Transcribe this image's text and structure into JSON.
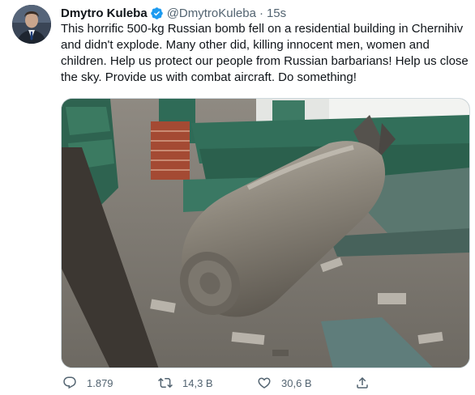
{
  "tweet": {
    "author_name": "Dmytro Kuleba",
    "handle": "@DmytroKuleba",
    "separator": "·",
    "time": "15s",
    "text": "This horrific 500-kg Russian bomb fell on a residential building in Chernihiv and didn't explode. Many other did, killing innocent men, women and children. Help us protect our people from Russian barbarians! Help us close the sky. Provide us with combat aircraft. Do something!"
  },
  "actions": {
    "reply_count": "1.879",
    "retweet_count": "14,3 B",
    "like_count": "30,6 B"
  },
  "icons": {
    "avatar": "avatar",
    "verified": "verified-badge-icon",
    "reply": "reply-icon",
    "retweet": "retweet-icon",
    "like": "heart-icon",
    "share": "share-icon"
  },
  "colors": {
    "verified_blue": "#1d9bf0",
    "secondary_text": "#536471",
    "primary_text": "#0f1419"
  }
}
